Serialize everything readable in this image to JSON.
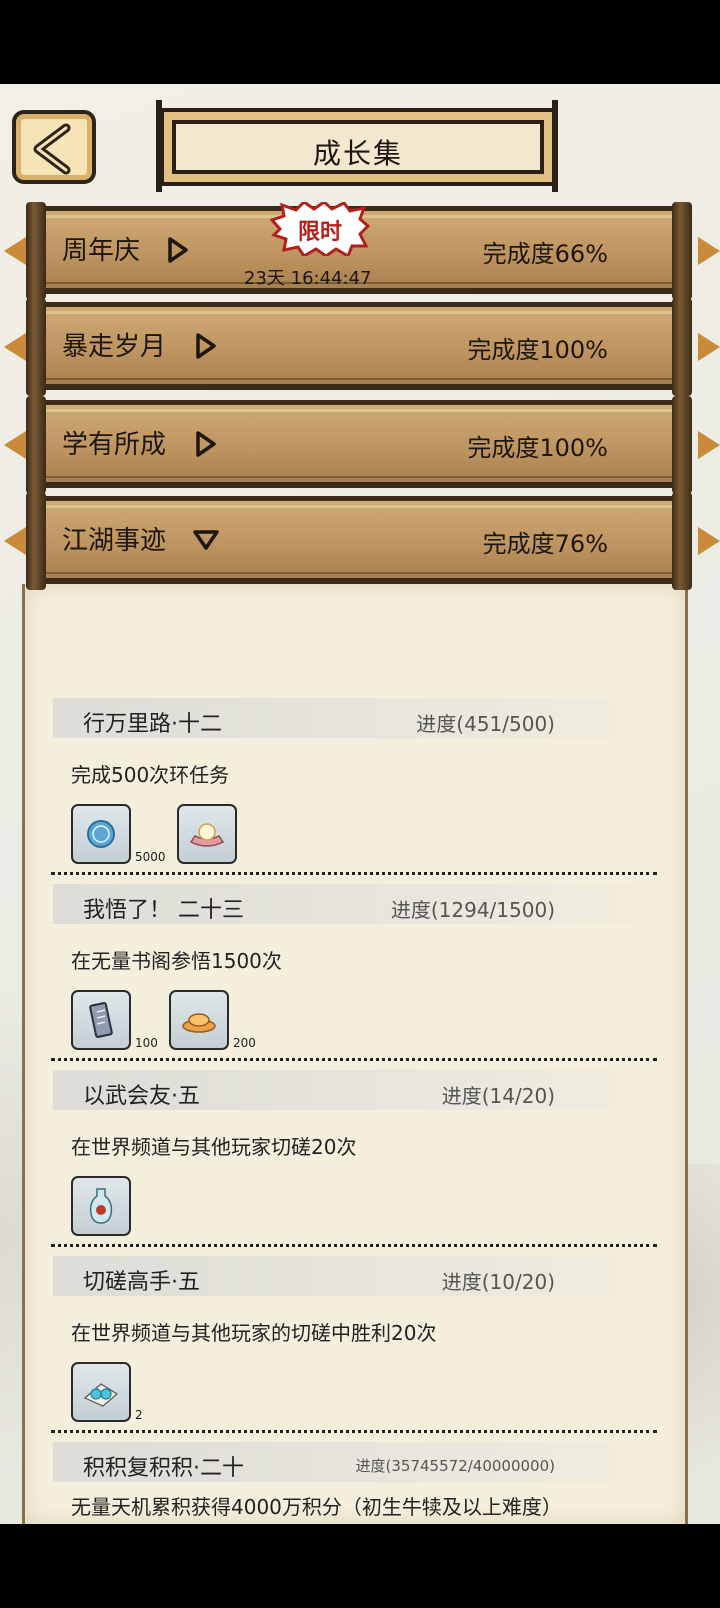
{
  "header": {
    "back_icon": "back-arrow-icon",
    "title": "成长集"
  },
  "categories": [
    {
      "name": "周年庆",
      "progress": "完成度66%",
      "badge": "限时",
      "timer": "23天 16:44:47",
      "state": "collapsed"
    },
    {
      "name": "暴走岁月",
      "progress": "完成度100%",
      "state": "collapsed"
    },
    {
      "name": "学有所成",
      "progress": "完成度100%",
      "state": "collapsed"
    },
    {
      "name": "江湖事迹",
      "progress": "完成度76%",
      "state": "expanded"
    }
  ],
  "tasks": [
    {
      "name": "行万里路·十二",
      "progress": "进度(451/500)",
      "desc": "完成500次环任务",
      "rewards": [
        {
          "icon": "coin-icon",
          "count": "5000"
        },
        {
          "icon": "pearl-shell-icon",
          "count": ""
        }
      ]
    },
    {
      "name": "我悟了！ 二十三",
      "progress": "进度(1294/1500)",
      "desc": "在无量书阁参悟1500次",
      "rewards": [
        {
          "icon": "scroll-icon",
          "count": "100"
        },
        {
          "icon": "gold-ingot-icon",
          "count": "200"
        }
      ]
    },
    {
      "name": "以武会友·五",
      "progress": "进度(14/20)",
      "desc": "在世界频道与其他玩家切磋20次",
      "rewards": [
        {
          "icon": "vase-icon",
          "count": ""
        }
      ]
    },
    {
      "name": "切磋高手·五",
      "progress": "进度(10/20)",
      "desc": "在世界频道与其他玩家的切磋中胜利20次",
      "rewards": [
        {
          "icon": "jade-beads-icon",
          "count": "2"
        }
      ]
    },
    {
      "name": "积积复积积·二十",
      "progress": "进度(35745572/40000000)",
      "desc": "无量天机累积获得4000万积分（初生牛犊及以上难度）",
      "rewards": [
        {
          "icon": "flower-orb-icon",
          "count": ""
        }
      ]
    }
  ],
  "colors": {
    "bar": "#bf9561",
    "badge_text": "#b1211b",
    "panel_bg": "#f4eedc"
  }
}
